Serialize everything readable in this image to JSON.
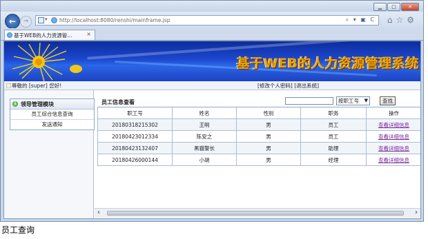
{
  "browser": {
    "url": "http://localhost:8080/renshi/mainframe.jsp",
    "tab_title": "基于WEB的人力资源管...",
    "tab_close": "×",
    "window_controls": [
      "▁",
      "□",
      "✕"
    ],
    "address_tools": "⌕ ▾ ▣ C",
    "toolbar_icons": [
      "home-icon",
      "star-icon",
      "gear-icon"
    ]
  },
  "banner": {
    "title": "基于WEB的人力资源管理系统"
  },
  "header": {
    "welcome": "尊敬的 [super] 您好!",
    "links": "[修改个人密码] [退出系统]"
  },
  "sidebar": {
    "group_title": "领导管理模块",
    "items": [
      {
        "label": "员工综合信息查询"
      },
      {
        "label": "发送通知"
      }
    ]
  },
  "main": {
    "panel_title": "员工信息查看",
    "search": {
      "value": "",
      "select_value": "按职工号",
      "button_label": "查找"
    },
    "columns": [
      "职工号",
      "姓名",
      "性别",
      "职务",
      "操作"
    ],
    "rows": [
      {
        "id": "20180318215302",
        "name": "王明",
        "gender": "男",
        "position": "员工",
        "action": "查看详细信息"
      },
      {
        "id": "20180423012334",
        "name": "陈安之",
        "gender": "男",
        "position": "员工",
        "action": "查看详细信息"
      },
      {
        "id": "20180423132407",
        "name": "黑猫警长",
        "gender": "男",
        "position": "助理",
        "action": "查看详细信息"
      },
      {
        "id": "20180426000144",
        "name": "小胡",
        "gender": "男",
        "position": "经理",
        "action": "查看详细信息"
      }
    ]
  },
  "caption": "员工查询",
  "colors": {
    "banner_blue": "#1c47cf",
    "banner_title": "#e3a40a",
    "link_purple": "#7d2a9a",
    "frame_blue": "#c9d7ea"
  }
}
